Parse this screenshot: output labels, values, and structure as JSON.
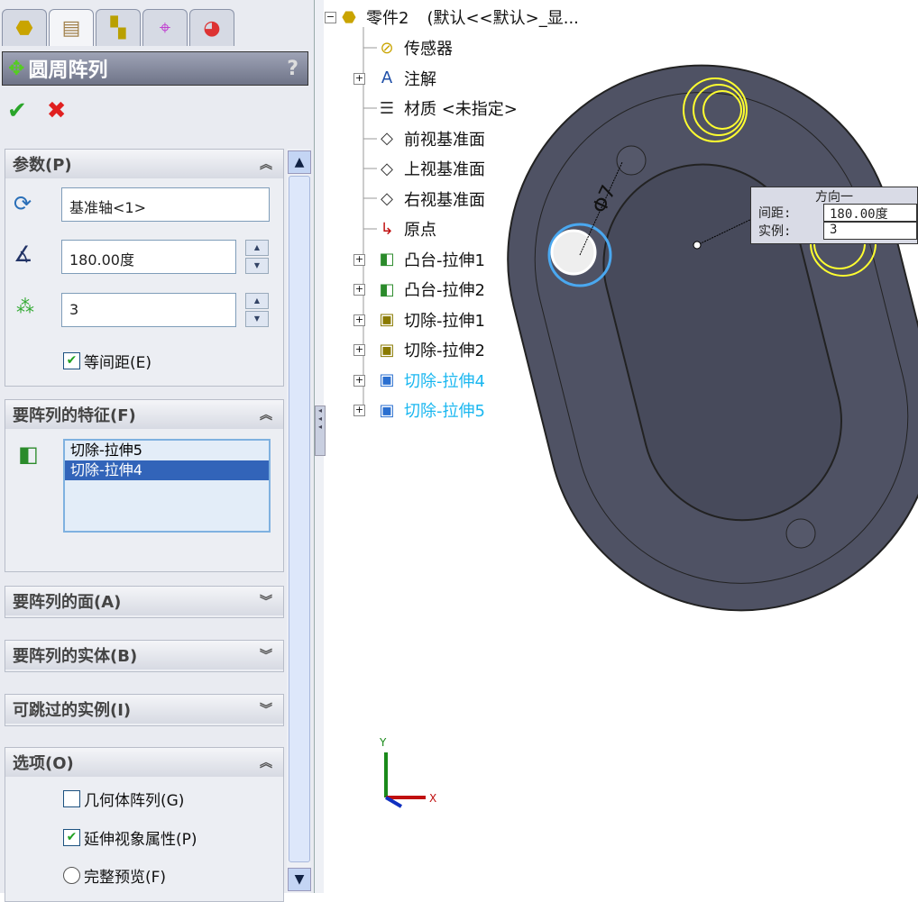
{
  "tabs": [
    {
      "name": "feature-manager"
    },
    {
      "name": "property-manager"
    },
    {
      "name": "configuration-manager"
    },
    {
      "name": "dimxpert"
    },
    {
      "name": "display-manager"
    }
  ],
  "title": "圆周阵列",
  "help": "?",
  "sections": {
    "params": {
      "label": "参数(P)",
      "axis": "基准轴<1>",
      "angle": "180.00度",
      "count": "3",
      "equal_spacing": "等间距(E)"
    },
    "features": {
      "label": "要阵列的特征(F)",
      "items": [
        "切除-拉伸5",
        "切除-拉伸4"
      ]
    },
    "faces": {
      "label": "要阵列的面(A)"
    },
    "bodies": {
      "label": "要阵列的实体(B)"
    },
    "skip": {
      "label": "可跳过的实例(I)"
    },
    "options": {
      "label": "选项(O)",
      "geometry": "几何体阵列(G)",
      "propagate": "延伸视象属性(P)",
      "full_preview": "完整预览(F)"
    }
  },
  "tree": {
    "root": "零件2",
    "root_config": "(默认<<默认>_显...",
    "items": [
      "传感器",
      "注解",
      "材质 <未指定>",
      "前视基准面",
      "上视基准面",
      "右视基准面",
      "原点",
      "凸台-拉伸1",
      "凸台-拉伸2",
      "切除-拉伸1",
      "切除-拉伸2",
      "切除-拉伸4",
      "切除-拉伸5"
    ]
  },
  "callout": {
    "title": "方向一",
    "spacing_label": "间距:",
    "spacing": "180.00度",
    "instances_label": "实例:",
    "instances": "3"
  },
  "dimension": "Φ7",
  "triad": {
    "x": "X",
    "y": "Y"
  }
}
